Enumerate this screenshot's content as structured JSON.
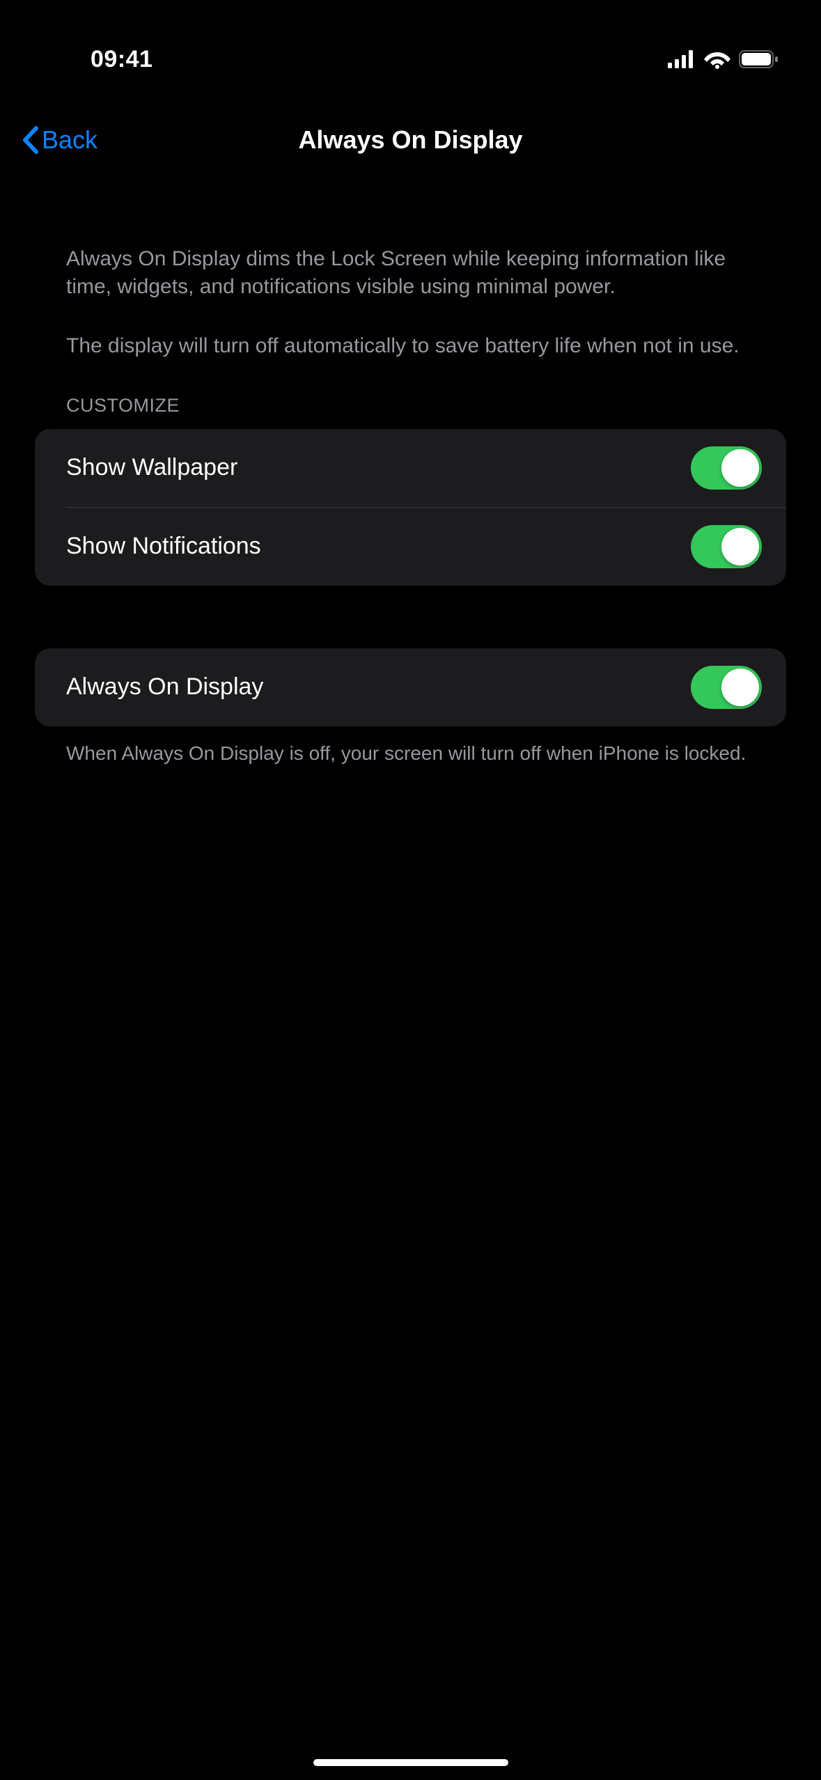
{
  "statusBar": {
    "time": "09:41"
  },
  "nav": {
    "back": "Back",
    "title": "Always On Display"
  },
  "description": {
    "p1": "Always On Display dims the Lock Screen while keeping information like time, widgets, and notifications visible using minimal power.",
    "p2": "The display will turn off automatically to save battery life when not in use."
  },
  "sections": {
    "customize": {
      "header": "CUSTOMIZE",
      "rows": [
        {
          "label": "Show Wallpaper",
          "enabled": true
        },
        {
          "label": "Show Notifications",
          "enabled": true
        }
      ]
    },
    "main": {
      "rows": [
        {
          "label": "Always On Display",
          "enabled": true
        }
      ],
      "footer": "When Always On Display is off, your screen will turn off when iPhone is locked."
    }
  }
}
